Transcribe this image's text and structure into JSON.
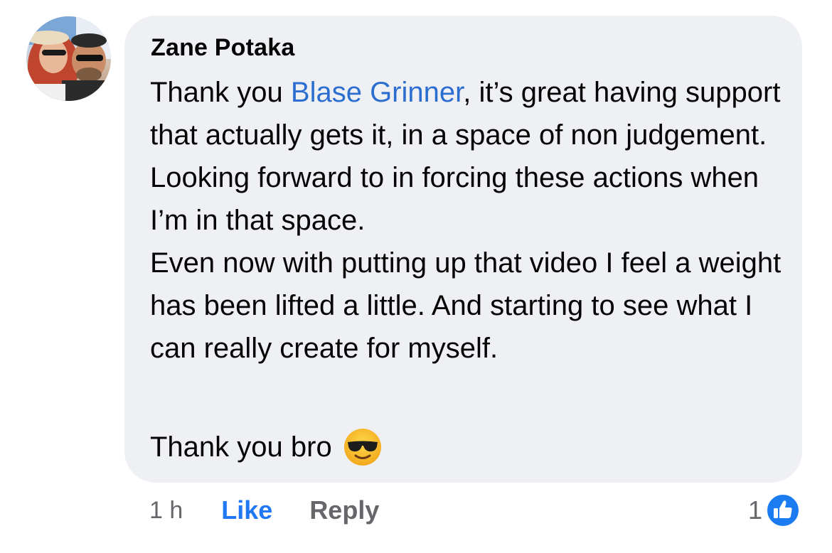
{
  "comment": {
    "author": "Zane Potaka",
    "text_before_mention": "Thank you ",
    "mention": "Blase Grinner",
    "text_after_mention": ", it’s great having support that actually gets it, in a space of non judgement. Looking forward to in forcing these actions when I’m in that space.",
    "paragraph_2": "Even now with putting up that video I feel a weight has been lifted a little. And starting to see what I can really create for myself.",
    "closing": "Thank you bro",
    "emoji": "smiling-face-with-sunglasses"
  },
  "actions": {
    "time": "1 h",
    "like_label": "Like",
    "reply_label": "Reply"
  },
  "reactions": {
    "count": "1",
    "type": "like-icon"
  },
  "colors": {
    "bubble": "#eff0f4",
    "mention": "#2c6ed0",
    "like_link": "#2078f4",
    "muted": "#65676b"
  }
}
